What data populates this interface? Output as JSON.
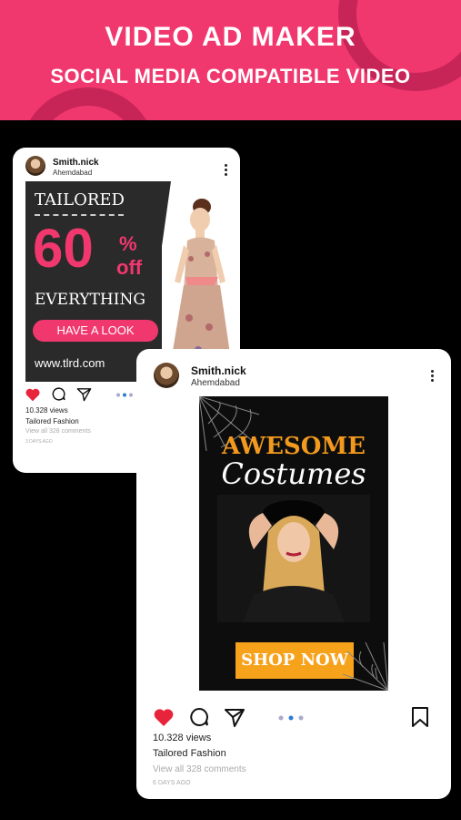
{
  "banner": {
    "title": "VIDEO  AD MAKER",
    "subtitle": "SOCIAL MEDIA COMPATIBLE VIDEO"
  },
  "post1": {
    "username": "Smith.nick",
    "location": "Ahemdabad",
    "ad": {
      "headline": "TAILORED",
      "discount": "60",
      "percent": "%",
      "off": "off",
      "everything": "EVERYTHING",
      "cta": "HAVE A LOOK",
      "url": "www.tlrd.com"
    },
    "views": "10.328 views",
    "caption": "Tailored Fashion",
    "comments": "View all 328 comments",
    "age": "3 DAYS AGO"
  },
  "post2": {
    "username": "Smith.nick",
    "location": "Ahemdabad",
    "ad": {
      "headline": "AWESOME",
      "subheadline": "Costumes",
      "cta": "SHOP NOW"
    },
    "views": "10.328 views",
    "caption": "Tailored Fashion",
    "comments": "View all 328 comments",
    "age": "6 DAYS AGO"
  },
  "colors": {
    "brand_pink": "#f0386e",
    "like_red": "#e8243a",
    "shop_orange": "#f7a21b",
    "carousel_active": "#2b7bd6"
  },
  "icons": [
    "heart-icon",
    "comment-icon",
    "share-icon",
    "bookmark-icon",
    "more-icon"
  ]
}
